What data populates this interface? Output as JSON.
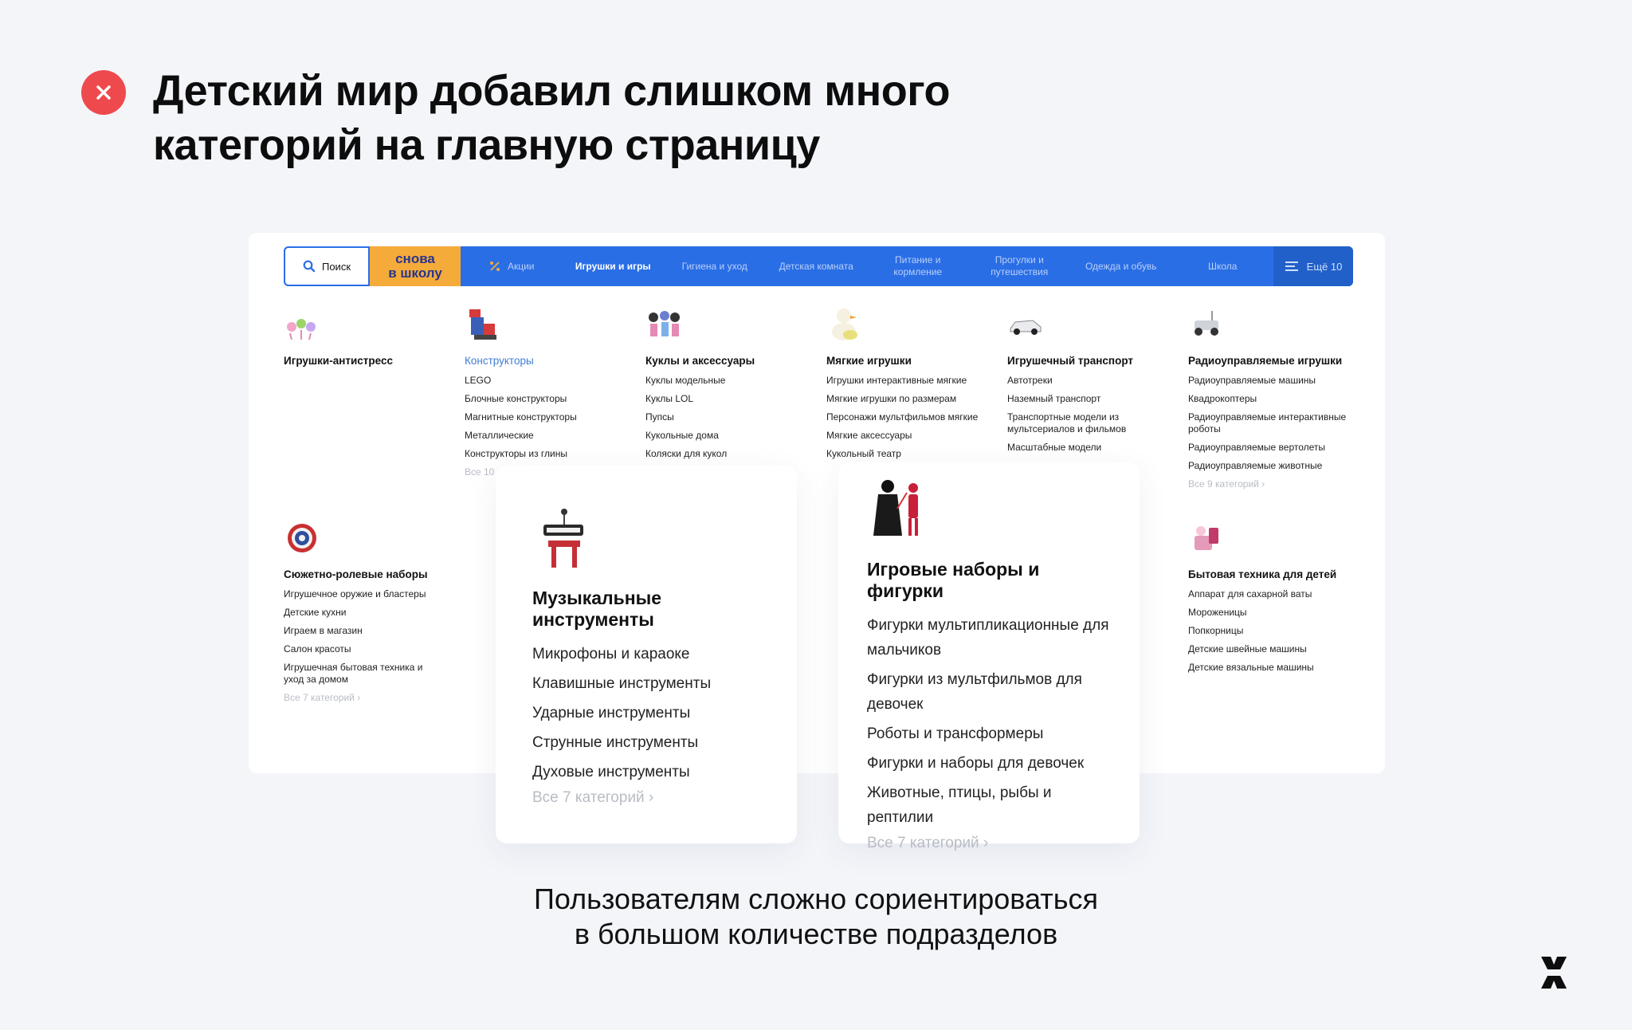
{
  "heading": {
    "line1": "Детский мир добавил слишком много",
    "line2": "категорий на главную страницу"
  },
  "nav": {
    "search": "Поиск",
    "school_line1": "снова",
    "school_line2": "в школу",
    "items": [
      {
        "label": "Акции"
      },
      {
        "label": "Игрушки и игры"
      },
      {
        "label": "Гигиена и уход"
      },
      {
        "label": "Детская комната"
      },
      {
        "label": "Питание и кормление"
      },
      {
        "label": "Прогулки и путешествия"
      },
      {
        "label": "Одежда и обувь"
      },
      {
        "label": "Школа"
      }
    ],
    "more": "Ещё 10"
  },
  "categories": [
    {
      "title": "Игрушки-антистресс",
      "subs": [],
      "all": ""
    },
    {
      "title": "Конструкторы",
      "subs": [
        "LEGO",
        "Блочные конструкторы",
        "Магнитные конструкторы",
        "Металлические",
        "Конструкторы из глины"
      ],
      "all": "Все 10"
    },
    {
      "title": "Куклы и аксессуары",
      "subs": [
        "Куклы модельные",
        "Куклы LOL",
        "Пупсы",
        "Кукольные дома",
        "Коляски для кукол"
      ],
      "all": ""
    },
    {
      "title": "Мягкие игрушки",
      "subs": [
        "Игрушки интерактивные мягкие",
        "Мягкие игрушки по размерам",
        "Персонажи мультфильмов мягкие",
        "Мягкие аксессуары",
        "Кукольный театр"
      ],
      "all": ""
    },
    {
      "title": "Игрушечный транспорт",
      "subs": [
        "Автотреки",
        "Наземный транспорт",
        "Транспортные модели из мультсериалов и фильмов",
        "Масштабные модели"
      ],
      "all": ""
    },
    {
      "title": "Радиоуправляемые игрушки",
      "subs": [
        "Радиоуправляемые машины",
        "Квадрокоптеры",
        "Радиоуправляемые интерактивные роботы",
        "Радиоуправляемые вертолеты",
        "Радиоуправляемые животные"
      ],
      "all": "Все 9 категорий"
    },
    {
      "title": "Сюжетно-ролевые наборы",
      "subs": [
        "Игрушечное оружие и бластеры",
        "Детские кухни",
        "Играем в магазин",
        "Салон красоты",
        "Игрушечная бытовая техника и уход за домом"
      ],
      "all": "Все 7 категорий"
    },
    {
      "title": "Бытовая техника для детей",
      "subs": [
        "Аппарат для сахарной ваты",
        "Мороженицы",
        "Попкорницы",
        "Детские швейные машины",
        "Детские вязальные машины"
      ],
      "all": ""
    }
  ],
  "callouts": [
    {
      "title": "Музыкальные инструменты",
      "subs": [
        "Микрофоны и караоке",
        "Клавишные инструменты",
        "Ударные инструменты",
        "Струнные инструменты",
        "Духовые инструменты"
      ],
      "all": "Все 7 категорий"
    },
    {
      "title": "Игровые наборы и фигурки",
      "subs": [
        "Фигурки мультипликационные для мальчиков",
        "Фигурки из мультфильмов для девочек",
        "Роботы и трансформеры",
        "Фигурки и наборы для девочек",
        "Животные, птицы, рыбы и рептилии"
      ],
      "all": "Все 7 категорий"
    }
  ],
  "caption": {
    "line1": "Пользователям сложно сориентироваться",
    "line2": "в большом количестве подразделов"
  },
  "colors": {
    "accent": "#2a6ee6",
    "error": "#ee4a4e",
    "school": "#f5ab3a"
  }
}
